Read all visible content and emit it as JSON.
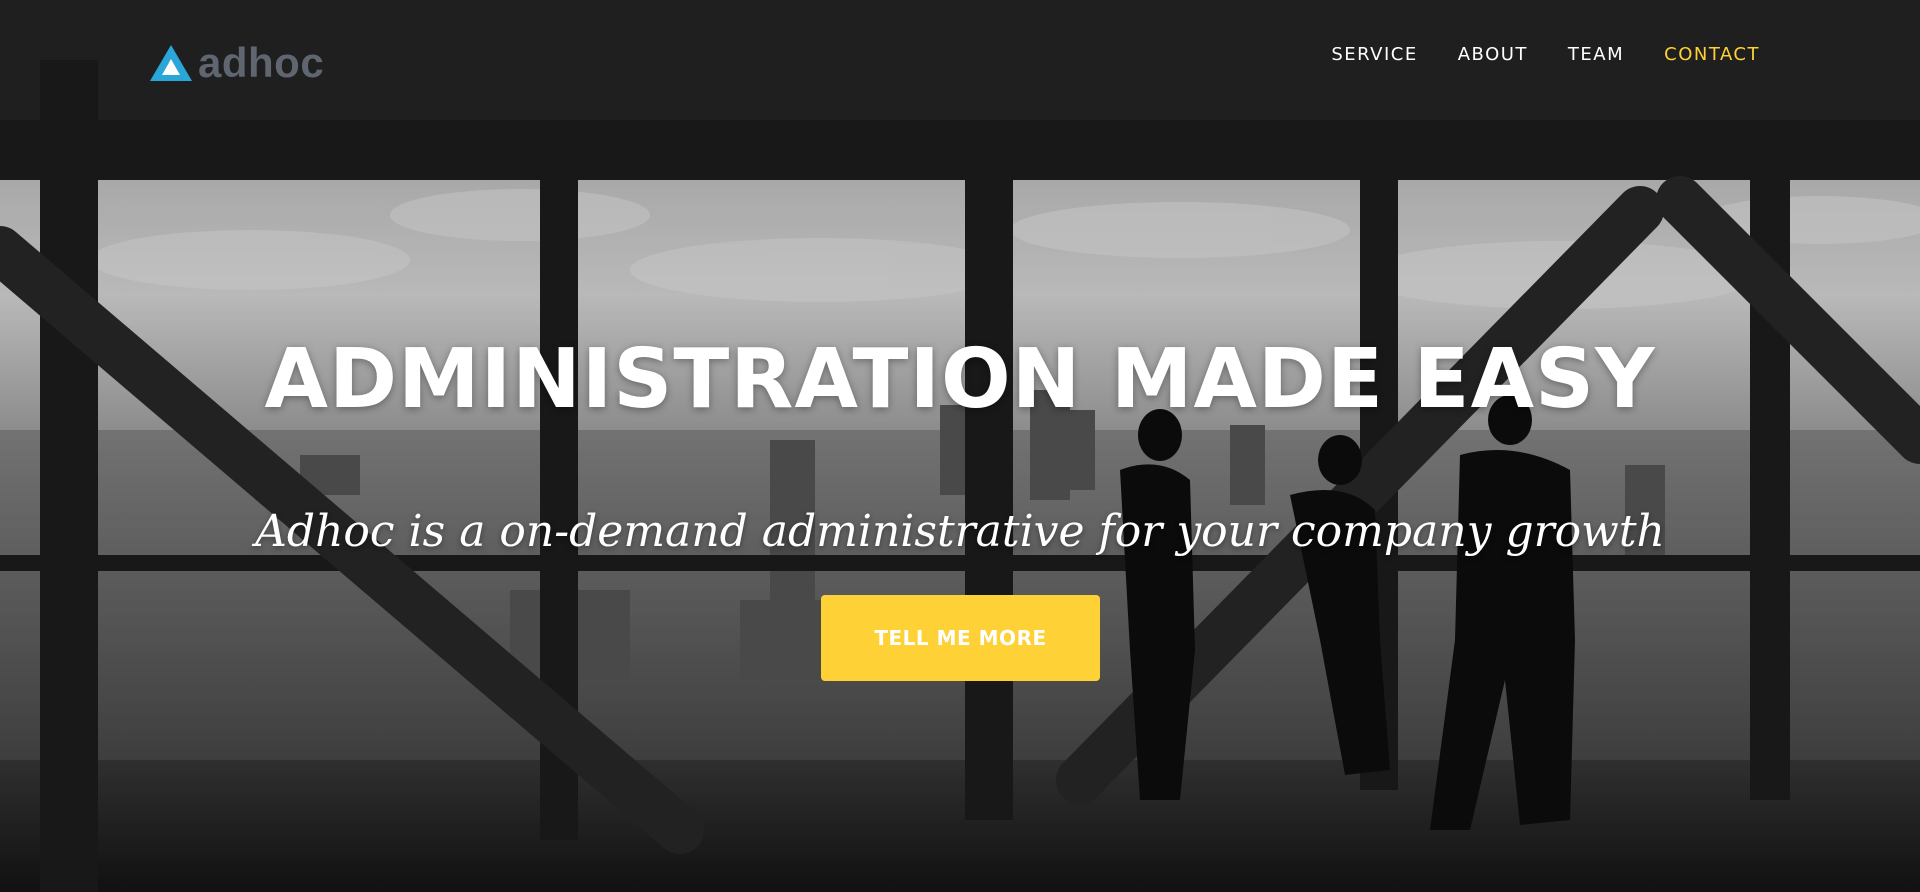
{
  "brand": {
    "name": "adhoc",
    "icon": "triangle-logo-icon",
    "color": "#5f6670",
    "icon_color": "#2aa6d8"
  },
  "nav": {
    "items": [
      {
        "label": "SERVICE",
        "active": false
      },
      {
        "label": "ABOUT",
        "active": false
      },
      {
        "label": "TEAM",
        "active": false
      },
      {
        "label": "CONTACT",
        "active": true
      }
    ],
    "active_color": "#fed136"
  },
  "hero": {
    "headline": "ADMINISTRATION MADE EASY",
    "subheadline": "Adhoc is a on-demand administrative for your company growth",
    "cta_label": "TELL ME MORE",
    "cta_color": "#fed136",
    "background": "grayscale photo of office interior with large windows overlooking city skyline and three silhouetted people"
  }
}
